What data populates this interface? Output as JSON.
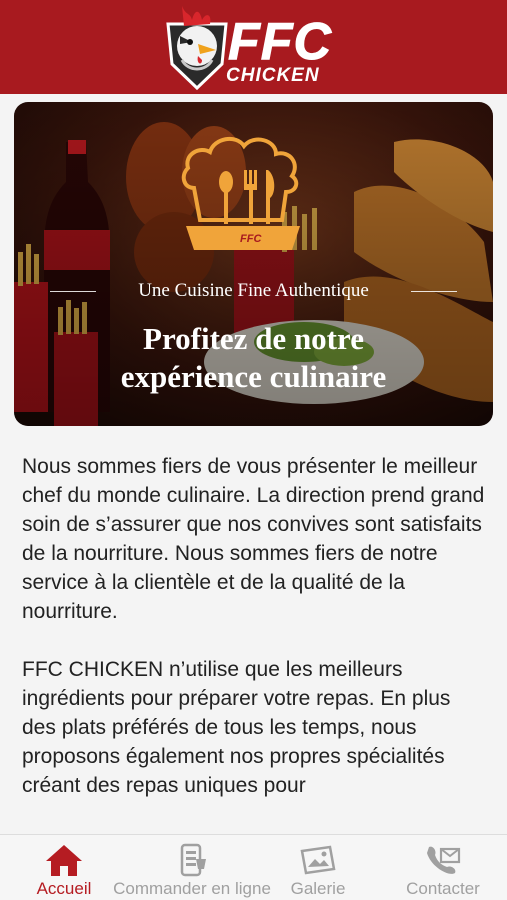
{
  "header": {
    "brand_main": "FFC",
    "brand_sub": "CHICKEN",
    "background_color": "#a81a1f"
  },
  "hero": {
    "subtitle": "Une Cuisine Fine Authentique",
    "title_line1": "Profitez de notre",
    "title_line2": "expérience culinaire",
    "chef_icon": "chef-hat-utensils-icon",
    "chef_badge": "FFC"
  },
  "content": {
    "paragraphs": [
      "Nous sommes fiers de vous présenter le meilleur chef du monde culinaire. La direction prend grand soin de s’assurer que nos convives sont satisfaits de la nourriture. Nous sommes fiers de notre service à la clientèle et de la qualité de la nourriture.",
      "FFC CHICKEN n’utilise que les meilleurs ingrédients pour préparer votre repas. En plus des plats préférés de tous les temps, nous proposons également nos propres spécialités créant des repas uniques pour"
    ]
  },
  "tabbar": {
    "active_color": "#b51c22",
    "inactive_color": "#a0a0a0",
    "items": [
      {
        "label": "Accueil",
        "icon": "home-icon",
        "active": true
      },
      {
        "label": "Commander en ligne",
        "icon": "order-online-icon",
        "active": false
      },
      {
        "label": "Galerie",
        "icon": "gallery-icon",
        "active": false
      },
      {
        "label": "Contacter",
        "icon": "contact-icon",
        "active": false
      }
    ]
  }
}
